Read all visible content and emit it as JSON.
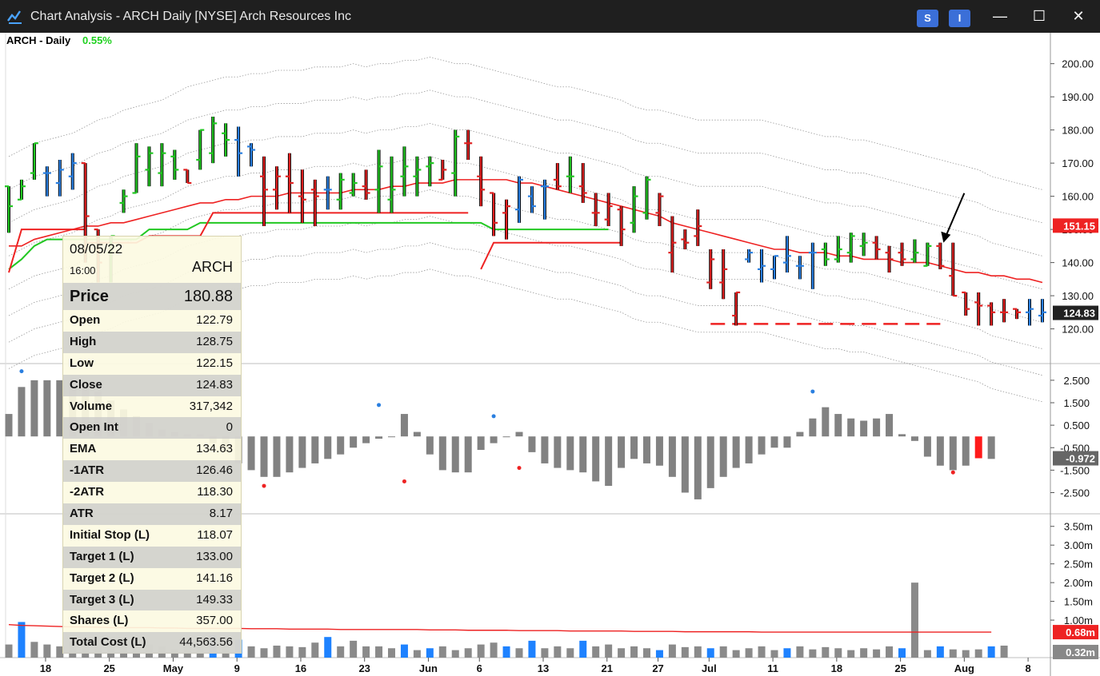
{
  "window": {
    "title": "Chart Analysis - ARCH Daily [NYSE] Arch Resources Inc",
    "buttons": [
      "S",
      "I"
    ],
    "controls": [
      "minimize",
      "maximize",
      "close"
    ]
  },
  "header": {
    "symbol_label": "ARCH - Daily",
    "change_pct": "0.55%",
    "change_color": "#1fd11f"
  },
  "colors": {
    "up": "#22c822",
    "down": "#e02020",
    "neutral": "#2a7fe0",
    "ema": "#ee2222",
    "atr_band": "#999999",
    "hist": "#808080",
    "price_tag": "#ee2222",
    "last_tag": "#222222"
  },
  "infobox": {
    "date": "08/05/22",
    "time": "16:00",
    "symbol": "ARCH",
    "rows": [
      {
        "k": "Price",
        "v": "180.88"
      },
      {
        "k": "Open",
        "v": "122.79"
      },
      {
        "k": "High",
        "v": "128.75"
      },
      {
        "k": "Low",
        "v": "122.15"
      },
      {
        "k": "Close",
        "v": "124.83"
      },
      {
        "k": "Volume",
        "v": "317,342"
      },
      {
        "k": "Open Int",
        "v": "0"
      },
      {
        "k": "EMA",
        "v": "134.63"
      },
      {
        "k": "-1ATR",
        "v": "126.46"
      },
      {
        "k": "-2ATR",
        "v": "118.30"
      },
      {
        "k": "ATR",
        "v": "8.17"
      },
      {
        "k": "Initial Stop (L)",
        "v": "118.07"
      },
      {
        "k": "Target 1 (L)",
        "v": "133.00"
      },
      {
        "k": "Target 2 (L)",
        "v": "141.16"
      },
      {
        "k": "Target 3 (L)",
        "v": "149.33"
      },
      {
        "k": "Shares (L)",
        "v": "357.00"
      },
      {
        "k": "Total Cost (L)",
        "v": "44,563.56"
      }
    ]
  },
  "chart_data": {
    "type": "ohlc",
    "x_ticks": [
      {
        "label": "18",
        "i": 1
      },
      {
        "label": "25",
        "i": 6
      },
      {
        "label": "May",
        "i": 11
      },
      {
        "label": "9",
        "i": 16
      },
      {
        "label": "16",
        "i": 21
      },
      {
        "label": "23",
        "i": 26
      },
      {
        "label": "Jun",
        "i": 31
      },
      {
        "label": "6",
        "i": 35
      },
      {
        "label": "13",
        "i": 40
      },
      {
        "label": "21",
        "i": 45
      },
      {
        "label": "27",
        "i": 49
      },
      {
        "label": "Jul",
        "i": 53
      },
      {
        "label": "11",
        "i": 58
      },
      {
        "label": "18",
        "i": 63
      },
      {
        "label": "25",
        "i": 68
      },
      {
        "label": "Aug",
        "i": 73
      },
      {
        "label": "8",
        "i": 78
      }
    ],
    "price_axis": {
      "ylim": [
        110.5,
        204.5
      ],
      "ticks": [
        "200.00",
        "190.00",
        "180.00",
        "170.00",
        "160.00",
        "150.00",
        "140.00",
        "130.00",
        "120.00"
      ]
    },
    "last_price_tags": [
      {
        "value": "151.15",
        "price": 151.15,
        "color": "#ee2222"
      },
      {
        "value": "124.83",
        "price": 124.83,
        "color": "#222222"
      }
    ],
    "bars": [
      [
        163,
        149,
        163,
        157,
        "u"
      ],
      [
        159,
        165,
        159,
        163,
        "u"
      ],
      [
        167,
        176,
        165,
        176,
        "u"
      ],
      [
        167,
        160,
        169,
        167,
        "n"
      ],
      [
        164,
        171,
        160,
        168,
        "n"
      ],
      [
        166,
        173,
        162,
        170,
        "n"
      ],
      [
        170,
        170,
        140,
        154,
        "d"
      ],
      [
        150,
        150,
        134,
        140,
        "d"
      ],
      [
        143,
        148,
        134,
        148,
        "u"
      ],
      [
        158,
        162,
        155,
        160,
        "u"
      ],
      [
        161,
        176,
        161,
        172,
        "u"
      ],
      [
        168,
        175,
        163,
        173,
        "u"
      ],
      [
        167,
        176,
        163,
        173,
        "u"
      ],
      [
        172,
        174,
        165,
        168,
        "u"
      ],
      [
        168,
        168,
        164,
        164,
        "d"
      ],
      [
        171,
        180,
        168,
        180,
        "u"
      ],
      [
        173,
        184,
        170,
        182,
        "u"
      ],
      [
        179,
        182,
        172,
        177,
        "u"
      ],
      [
        177,
        181,
        166,
        173,
        "n"
      ],
      [
        175,
        176,
        169,
        174,
        "n"
      ],
      [
        166,
        172,
        151,
        162,
        "d"
      ],
      [
        162,
        169,
        156,
        166,
        "d"
      ],
      [
        166,
        173,
        155,
        164,
        "d"
      ],
      [
        160,
        168,
        152,
        159,
        "d"
      ],
      [
        162,
        165,
        151,
        160,
        "d"
      ],
      [
        162,
        166,
        156,
        162,
        "n"
      ],
      [
        159,
        167,
        156,
        165,
        "u"
      ],
      [
        161,
        167,
        160,
        164,
        "u"
      ],
      [
        163,
        168,
        159,
        161,
        "d"
      ],
      [
        162,
        174,
        155,
        169,
        "u"
      ],
      [
        159,
        172,
        155,
        162,
        "u"
      ],
      [
        166,
        175,
        160,
        169,
        "u"
      ],
      [
        166,
        172,
        160,
        168,
        "u"
      ],
      [
        169,
        172,
        163,
        170,
        "u"
      ],
      [
        165,
        171,
        165,
        168,
        "d"
      ],
      [
        167,
        180,
        160,
        178,
        "u"
      ],
      [
        176,
        180,
        171,
        176,
        "d"
      ],
      [
        166,
        172,
        157,
        162,
        "d"
      ],
      [
        161,
        161,
        148,
        152,
        "d"
      ],
      [
        155,
        159,
        147,
        157,
        "d"
      ],
      [
        156,
        166,
        152,
        165,
        "n"
      ],
      [
        160,
        163,
        155,
        157,
        "n"
      ],
      [
        163,
        165,
        153,
        163,
        "n"
      ],
      [
        165,
        170,
        162,
        163,
        "d"
      ],
      [
        166,
        172,
        161,
        166,
        "u"
      ],
      [
        163,
        170,
        158,
        161,
        "d"
      ],
      [
        155,
        161,
        151,
        155,
        "d"
      ],
      [
        153,
        161,
        151,
        157,
        "d"
      ],
      [
        156,
        157,
        145,
        150,
        "d"
      ],
      [
        152,
        163,
        149,
        160,
        "u"
      ],
      [
        155,
        166,
        153,
        165,
        "u"
      ],
      [
        155,
        161,
        151,
        160,
        "d"
      ],
      [
        143,
        154,
        137,
        146,
        "d"
      ],
      [
        147,
        150,
        144,
        146,
        "d"
      ],
      [
        148,
        156,
        145,
        151,
        "d"
      ],
      [
        134,
        144,
        132,
        141,
        "d"
      ],
      [
        134,
        144,
        129,
        138,
        "d"
      ],
      [
        124,
        131,
        121,
        131,
        "d"
      ],
      [
        141,
        144,
        140,
        143,
        "n"
      ],
      [
        138,
        144,
        134,
        139,
        "n"
      ],
      [
        138,
        142,
        135,
        142,
        "n"
      ],
      [
        140,
        148,
        137,
        142,
        "n"
      ],
      [
        139,
        142,
        135,
        139,
        "n"
      ],
      [
        143,
        146,
        132,
        143,
        "n"
      ],
      [
        144,
        146,
        139,
        141,
        "u"
      ],
      [
        141,
        148,
        140,
        144,
        "u"
      ],
      [
        143,
        149,
        140,
        148,
        "u"
      ],
      [
        145,
        149,
        142,
        146,
        "u"
      ],
      [
        146,
        148,
        141,
        144,
        "d"
      ],
      [
        143,
        145,
        137,
        141,
        "d"
      ],
      [
        143,
        146,
        139,
        141,
        "d"
      ],
      [
        141,
        147,
        140,
        143,
        "u"
      ],
      [
        139,
        146,
        139,
        145,
        "u"
      ],
      [
        145,
        146,
        138,
        139,
        "d"
      ],
      [
        136,
        146,
        130,
        130,
        "d"
      ],
      [
        131,
        131,
        124,
        126,
        "d"
      ],
      [
        128,
        131,
        121,
        127,
        "d"
      ],
      [
        127,
        128,
        121,
        125,
        "d"
      ],
      [
        125,
        129,
        122,
        125,
        "d"
      ],
      [
        126,
        126,
        123,
        125,
        "d"
      ],
      [
        125,
        129,
        121,
        126,
        "n"
      ],
      [
        124,
        129,
        122,
        125,
        "n"
      ]
    ],
    "ema": [
      145,
      145,
      147,
      148,
      149,
      150,
      151,
      151,
      152,
      152,
      153,
      154,
      155,
      156,
      157,
      158,
      158,
      159,
      159,
      160,
      160,
      160,
      161,
      161,
      161,
      161,
      161,
      162,
      162,
      162,
      163,
      163,
      164,
      164,
      164,
      165,
      165,
      165,
      165,
      165,
      164,
      164,
      163,
      162,
      161,
      160,
      159,
      158,
      157,
      156,
      155,
      154,
      152,
      151,
      150,
      149,
      148,
      147,
      146,
      145,
      144,
      144,
      143,
      143,
      143,
      142,
      142,
      141,
      141,
      141,
      140,
      140,
      140,
      139,
      138,
      137,
      137,
      136,
      136,
      135,
      135,
      134
    ],
    "atr_upper1": [
      172,
      174,
      176,
      177,
      178,
      179,
      181,
      183,
      184,
      186,
      187,
      188,
      189,
      191,
      193,
      194,
      195,
      196,
      196,
      197,
      197,
      198,
      198,
      198,
      199,
      199,
      199,
      200,
      199,
      200,
      200,
      201,
      201,
      202,
      201,
      200,
      200,
      199,
      198,
      197,
      196,
      195,
      194,
      193,
      193,
      192,
      191,
      190,
      189,
      187,
      186,
      186,
      185,
      184,
      183,
      183,
      183,
      183,
      183,
      183,
      182,
      181,
      180,
      179,
      178,
      178,
      177,
      177,
      176,
      175,
      174,
      173,
      172,
      171,
      170,
      169,
      168,
      166,
      165,
      164,
      163,
      162
    ],
    "trailing_stop": [
      [
        0,
        138
      ],
      [
        1,
        141
      ],
      [
        2,
        145
      ],
      [
        3,
        147
      ],
      [
        4,
        147
      ],
      [
        5,
        147
      ],
      [
        6,
        147
      ],
      [
        7,
        147
      ],
      [
        8,
        147
      ],
      [
        9,
        147
      ],
      [
        10,
        147
      ],
      [
        11,
        150
      ],
      [
        12,
        150
      ],
      [
        13,
        150
      ],
      [
        14,
        150
      ],
      [
        15,
        152
      ],
      [
        16,
        152
      ],
      [
        17,
        152
      ],
      [
        18,
        152
      ],
      [
        19,
        152
      ],
      [
        20,
        152
      ],
      [
        21,
        152
      ],
      [
        22,
        152
      ],
      [
        23,
        152
      ],
      [
        24,
        152
      ],
      [
        25,
        152
      ],
      [
        26,
        152
      ],
      [
        27,
        152
      ],
      [
        28,
        152
      ],
      [
        29,
        152
      ],
      [
        30,
        152
      ],
      [
        31,
        152
      ],
      [
        32,
        152
      ],
      [
        33,
        152
      ],
      [
        34,
        152
      ],
      [
        35,
        152
      ],
      [
        36,
        152
      ],
      [
        37,
        152
      ],
      [
        38,
        150
      ],
      [
        39,
        150
      ],
      [
        40,
        150
      ],
      [
        41,
        150
      ],
      [
        42,
        150
      ],
      [
        43,
        150
      ],
      [
        44,
        150
      ],
      [
        45,
        150
      ],
      [
        46,
        150
      ],
      [
        47,
        150
      ]
    ],
    "support_line": {
      "start_i": 55,
      "end_i": 73,
      "price": 121.5,
      "color": "#ee2222",
      "style": "dashed"
    },
    "annotation_arrow": {
      "at_i": 73,
      "price": 146
    },
    "oscillator": {
      "ticks": [
        "2.500",
        "1.500",
        "0.500",
        "-0.500",
        "-1.500",
        "-2.500"
      ],
      "ylim": [
        -3.3,
        3.1
      ],
      "last_value": "-0.972",
      "values": [
        1.0,
        2.2,
        2.5,
        2.5,
        2.5,
        2.4,
        2.3,
        2.0,
        1.6,
        1.2,
        0.9,
        0.6,
        0.3,
        0.2,
        0.1,
        0.1,
        -0.3,
        -0.7,
        -1.2,
        -1.5,
        -1.8,
        -1.8,
        -1.6,
        -1.4,
        -1.2,
        -1.0,
        -0.8,
        -0.5,
        -0.3,
        -0.1,
        0.0,
        1.0,
        0.2,
        -0.8,
        -1.5,
        -1.6,
        -1.6,
        -0.6,
        -0.3,
        0.0,
        0.2,
        -0.7,
        -1.2,
        -1.4,
        -1.5,
        -1.6,
        -2.0,
        -2.2,
        -1.4,
        -1.0,
        -1.2,
        -1.3,
        -1.8,
        -2.5,
        -2.8,
        -2.3,
        -1.8,
        -1.4,
        -1.2,
        -0.8,
        -0.5,
        -0.5,
        0.2,
        0.8,
        1.3,
        1.0,
        0.8,
        0.7,
        0.8,
        1.0,
        0.1,
        -0.2,
        -0.9,
        -1.3,
        -1.5,
        -1.3,
        -0.97,
        -1.0
      ],
      "dots": [
        {
          "i": 1,
          "v": 2.9,
          "c": "#2a7fe0"
        },
        {
          "i": 20,
          "v": -2.2,
          "c": "#ee2222"
        },
        {
          "i": 29,
          "v": 1.4,
          "c": "#2a7fe0"
        },
        {
          "i": 31,
          "v": -2.0,
          "c": "#ee2222"
        },
        {
          "i": 38,
          "v": 0.9,
          "c": "#2a7fe0"
        },
        {
          "i": 40,
          "v": -1.4,
          "c": "#ee2222"
        },
        {
          "i": 63,
          "v": 2.0,
          "c": "#2a7fe0"
        },
        {
          "i": 74,
          "v": -1.6,
          "c": "#ee2222"
        }
      ]
    },
    "volume": {
      "ticks": [
        "3.50m",
        "3.00m",
        "2.50m",
        "2.00m",
        "1.50m",
        "1.00m"
      ],
      "ylim": [
        0,
        3.75
      ],
      "avg_value": "0.68m",
      "last_value": "0.32m",
      "values": [
        0.35,
        0.95,
        0.42,
        0.35,
        0.3,
        0.42,
        0.35,
        0.3,
        0.45,
        0.38,
        0.25,
        0.35,
        0.3,
        0.22,
        0.35,
        0.3,
        0.6,
        0.35,
        0.48,
        0.3,
        0.25,
        0.32,
        0.3,
        0.28,
        0.4,
        0.55,
        0.3,
        0.45,
        0.3,
        0.3,
        0.25,
        0.35,
        0.2,
        0.25,
        0.3,
        0.2,
        0.25,
        0.35,
        0.4,
        0.3,
        0.25,
        0.45,
        0.25,
        0.3,
        0.25,
        0.45,
        0.3,
        0.35,
        0.25,
        0.3,
        0.25,
        0.2,
        0.35,
        0.28,
        0.3,
        0.25,
        0.3,
        0.2,
        0.25,
        0.3,
        0.2,
        0.25,
        0.3,
        0.22,
        0.28,
        0.25,
        0.2,
        0.25,
        0.22,
        0.3,
        0.25,
        2.0,
        0.2,
        0.3,
        0.22,
        0.2,
        0.22,
        0.3,
        0.32
      ],
      "colors_idx": {
        "blue": [
          1,
          16,
          18,
          25,
          31,
          33,
          39,
          41,
          45,
          51,
          55,
          61,
          70,
          73,
          77
        ]
      },
      "avg": [
        0.88,
        0.86,
        0.85,
        0.84,
        0.83,
        0.82,
        0.82,
        0.81,
        0.8,
        0.8,
        0.8,
        0.8,
        0.79,
        0.79,
        0.78,
        0.78,
        0.78,
        0.78,
        0.78,
        0.77,
        0.77,
        0.77,
        0.76,
        0.76,
        0.76,
        0.76,
        0.75,
        0.75,
        0.75,
        0.75,
        0.75,
        0.75,
        0.75,
        0.74,
        0.74,
        0.74,
        0.73,
        0.73,
        0.73,
        0.73,
        0.72,
        0.72,
        0.72,
        0.72,
        0.71,
        0.71,
        0.71,
        0.71,
        0.71,
        0.7,
        0.7,
        0.7,
        0.7,
        0.69,
        0.69,
        0.69,
        0.69,
        0.69,
        0.69,
        0.68,
        0.68,
        0.68,
        0.68,
        0.68,
        0.68,
        0.68,
        0.68,
        0.68,
        0.68,
        0.68,
        0.68,
        0.68,
        0.68,
        0.68,
        0.68,
        0.68,
        0.68,
        0.68
      ]
    }
  }
}
